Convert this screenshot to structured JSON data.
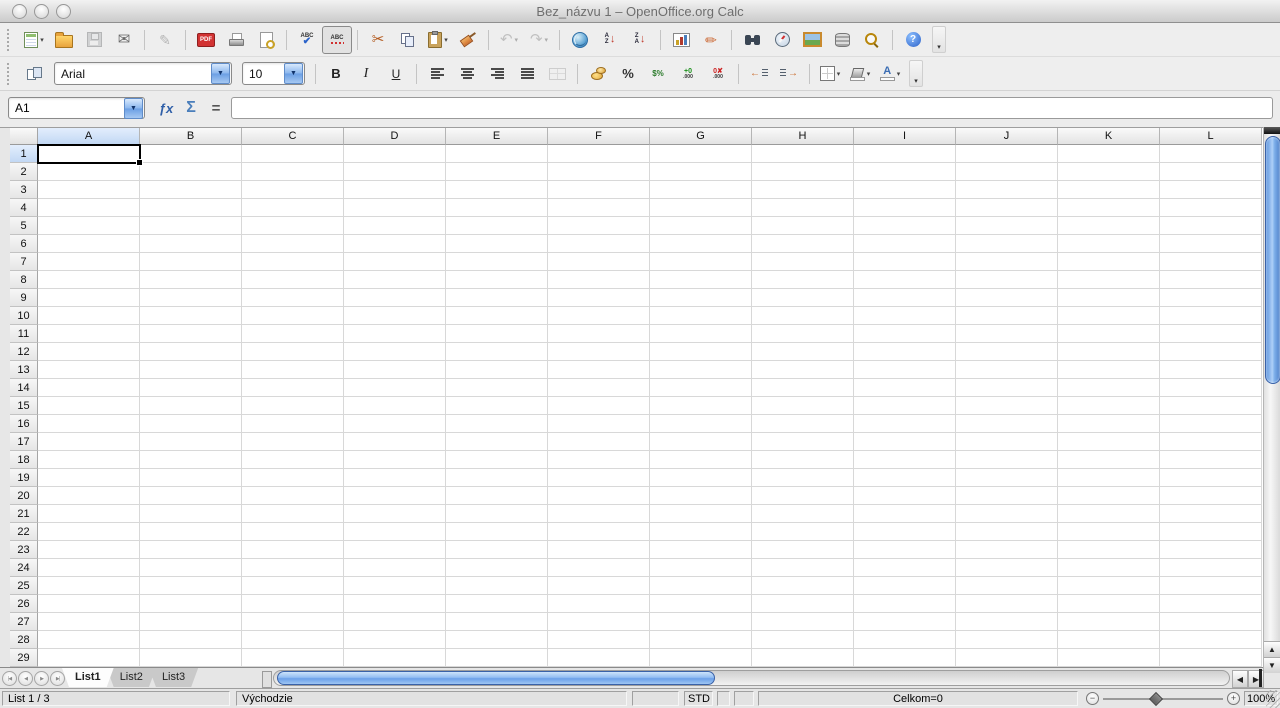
{
  "window": {
    "title": "Bez_názvu 1 – OpenOffice.org Calc"
  },
  "toolbar_standard": {
    "items": [
      {
        "type": "icon",
        "name": "new-document",
        "glyph": "",
        "dropdown": true
      },
      {
        "type": "icon",
        "name": "open-file",
        "glyph": ""
      },
      {
        "type": "icon",
        "name": "save-document",
        "glyph": "",
        "disabled": true
      },
      {
        "type": "icon",
        "name": "email-document",
        "glyph": "✉"
      },
      {
        "type": "sep"
      },
      {
        "type": "icon",
        "name": "edit-file",
        "glyph": "✎",
        "disabled": true
      },
      {
        "type": "sep"
      },
      {
        "type": "icon",
        "name": "export-pdf",
        "glyph": "PDF"
      },
      {
        "type": "icon",
        "name": "print-file",
        "glyph": ""
      },
      {
        "type": "icon",
        "name": "page-preview",
        "glyph": ""
      },
      {
        "type": "sep"
      },
      {
        "type": "icon",
        "name": "spellcheck",
        "glyph": "ABC"
      },
      {
        "type": "icon",
        "name": "auto-spellcheck",
        "glyph": "ABC",
        "pressed": true
      },
      {
        "type": "sep"
      },
      {
        "type": "icon",
        "name": "cut",
        "glyph": "✂"
      },
      {
        "type": "icon",
        "name": "copy",
        "glyph": ""
      },
      {
        "type": "icon",
        "name": "paste",
        "glyph": "",
        "dropdown": true
      },
      {
        "type": "icon",
        "name": "format-paintbrush",
        "glyph": ""
      },
      {
        "type": "sep"
      },
      {
        "type": "icon",
        "name": "undo",
        "glyph": "↶",
        "disabled": true,
        "dropdown": true
      },
      {
        "type": "icon",
        "name": "redo",
        "glyph": "↷",
        "disabled": true,
        "dropdown": true
      },
      {
        "type": "sep"
      },
      {
        "type": "icon",
        "name": "hyperlink",
        "glyph": ""
      },
      {
        "type": "icon",
        "name": "sort-ascending",
        "glyph": "↓"
      },
      {
        "type": "icon",
        "name": "sort-descending",
        "glyph": "↓"
      },
      {
        "type": "sep"
      },
      {
        "type": "icon",
        "name": "insert-chart",
        "glyph": ""
      },
      {
        "type": "icon",
        "name": "draw-functions",
        "glyph": "✏"
      },
      {
        "type": "sep"
      },
      {
        "type": "icon",
        "name": "find-replace",
        "glyph": ""
      },
      {
        "type": "icon",
        "name": "navigator",
        "glyph": ""
      },
      {
        "type": "icon",
        "name": "gallery",
        "glyph": ""
      },
      {
        "type": "icon",
        "name": "data-sources",
        "glyph": ""
      },
      {
        "type": "icon",
        "name": "zoom",
        "glyph": ""
      },
      {
        "type": "sep"
      },
      {
        "type": "icon",
        "name": "help",
        "glyph": "?"
      },
      {
        "type": "overflow",
        "name": "toolbar-options",
        "glyph": "▾"
      }
    ]
  },
  "toolbar_formatting": {
    "items": [
      {
        "type": "icon",
        "name": "styles-window",
        "glyph": ""
      },
      {
        "type": "combo",
        "name": "font-name",
        "value": "Arial",
        "button_glyph": "▼"
      },
      {
        "type": "combo",
        "name": "font-size",
        "value": "10",
        "button_glyph": "▼"
      },
      {
        "type": "sep"
      },
      {
        "type": "icon",
        "name": "bold",
        "glyph": "B"
      },
      {
        "type": "icon",
        "name": "italic",
        "glyph": "I"
      },
      {
        "type": "icon",
        "name": "underline",
        "glyph": "U"
      },
      {
        "type": "sep"
      },
      {
        "type": "icon",
        "name": "align-left",
        "glyph": ""
      },
      {
        "type": "icon",
        "name": "align-center",
        "glyph": ""
      },
      {
        "type": "icon",
        "name": "align-right",
        "glyph": ""
      },
      {
        "type": "icon",
        "name": "align-justified",
        "glyph": ""
      },
      {
        "type": "icon",
        "name": "merge-cells",
        "glyph": "",
        "disabled": true
      },
      {
        "type": "sep"
      },
      {
        "type": "icon",
        "name": "currency-format",
        "glyph": ""
      },
      {
        "type": "icon",
        "name": "percent-format",
        "glyph": "%"
      },
      {
        "type": "icon",
        "name": "standard-format",
        "glyph": "$%"
      },
      {
        "type": "icon",
        "name": "add-decimal",
        "glyph": ".000"
      },
      {
        "type": "icon",
        "name": "delete-decimal",
        "glyph": ".000"
      },
      {
        "type": "sep"
      },
      {
        "type": "icon",
        "name": "decrease-indent",
        "glyph": "←"
      },
      {
        "type": "icon",
        "name": "increase-indent",
        "glyph": "→"
      },
      {
        "type": "sep"
      },
      {
        "type": "icon",
        "name": "borders",
        "glyph": "",
        "dropdown": true
      },
      {
        "type": "icon",
        "name": "background-color",
        "glyph": "",
        "dropdown": true
      },
      {
        "type": "icon",
        "name": "font-color",
        "glyph": "A",
        "dropdown": true
      },
      {
        "type": "overflow",
        "name": "toolbar-options",
        "glyph": "▾"
      }
    ]
  },
  "formula_bar": {
    "cell_reference": "A1",
    "name_box_button_glyph": "▼",
    "function_wizard_glyph": "ƒx",
    "sum_glyph": "Σ",
    "equals_glyph": "=",
    "input_value": ""
  },
  "grid": {
    "columns": [
      "A",
      "B",
      "C",
      "D",
      "E",
      "F",
      "G",
      "H",
      "I",
      "J",
      "K",
      "L"
    ],
    "row_count": 29,
    "selected_cell": "A1"
  },
  "scrollbars": {
    "up_glyph": "▲",
    "down_glyph": "▼",
    "left_glyph": "◀",
    "right_glyph": "▶"
  },
  "sheet_tabs": {
    "nav_buttons": [
      {
        "name": "sheet-first",
        "glyph": "|◀"
      },
      {
        "name": "sheet-previous",
        "glyph": "◀"
      },
      {
        "name": "sheet-next",
        "glyph": "▶"
      },
      {
        "name": "sheet-last",
        "glyph": "▶|"
      }
    ],
    "tabs": [
      "List1",
      "List2",
      "List3"
    ],
    "active_tab": "List1"
  },
  "status_bar": {
    "sheet_position": "List 1 / 3",
    "page_style": "Východzie",
    "insert_mode": "STD",
    "selection_sum": "Celkom=0",
    "zoom_out_glyph": "−",
    "zoom_in_glyph": "+",
    "zoom_level": "100%"
  },
  "colors": {
    "selection_border": "#000000",
    "selected_header": "#c2d8f4",
    "scrollbar_thumb": "#7fb0ea",
    "titlebar_text": "#6e6e6e"
  }
}
